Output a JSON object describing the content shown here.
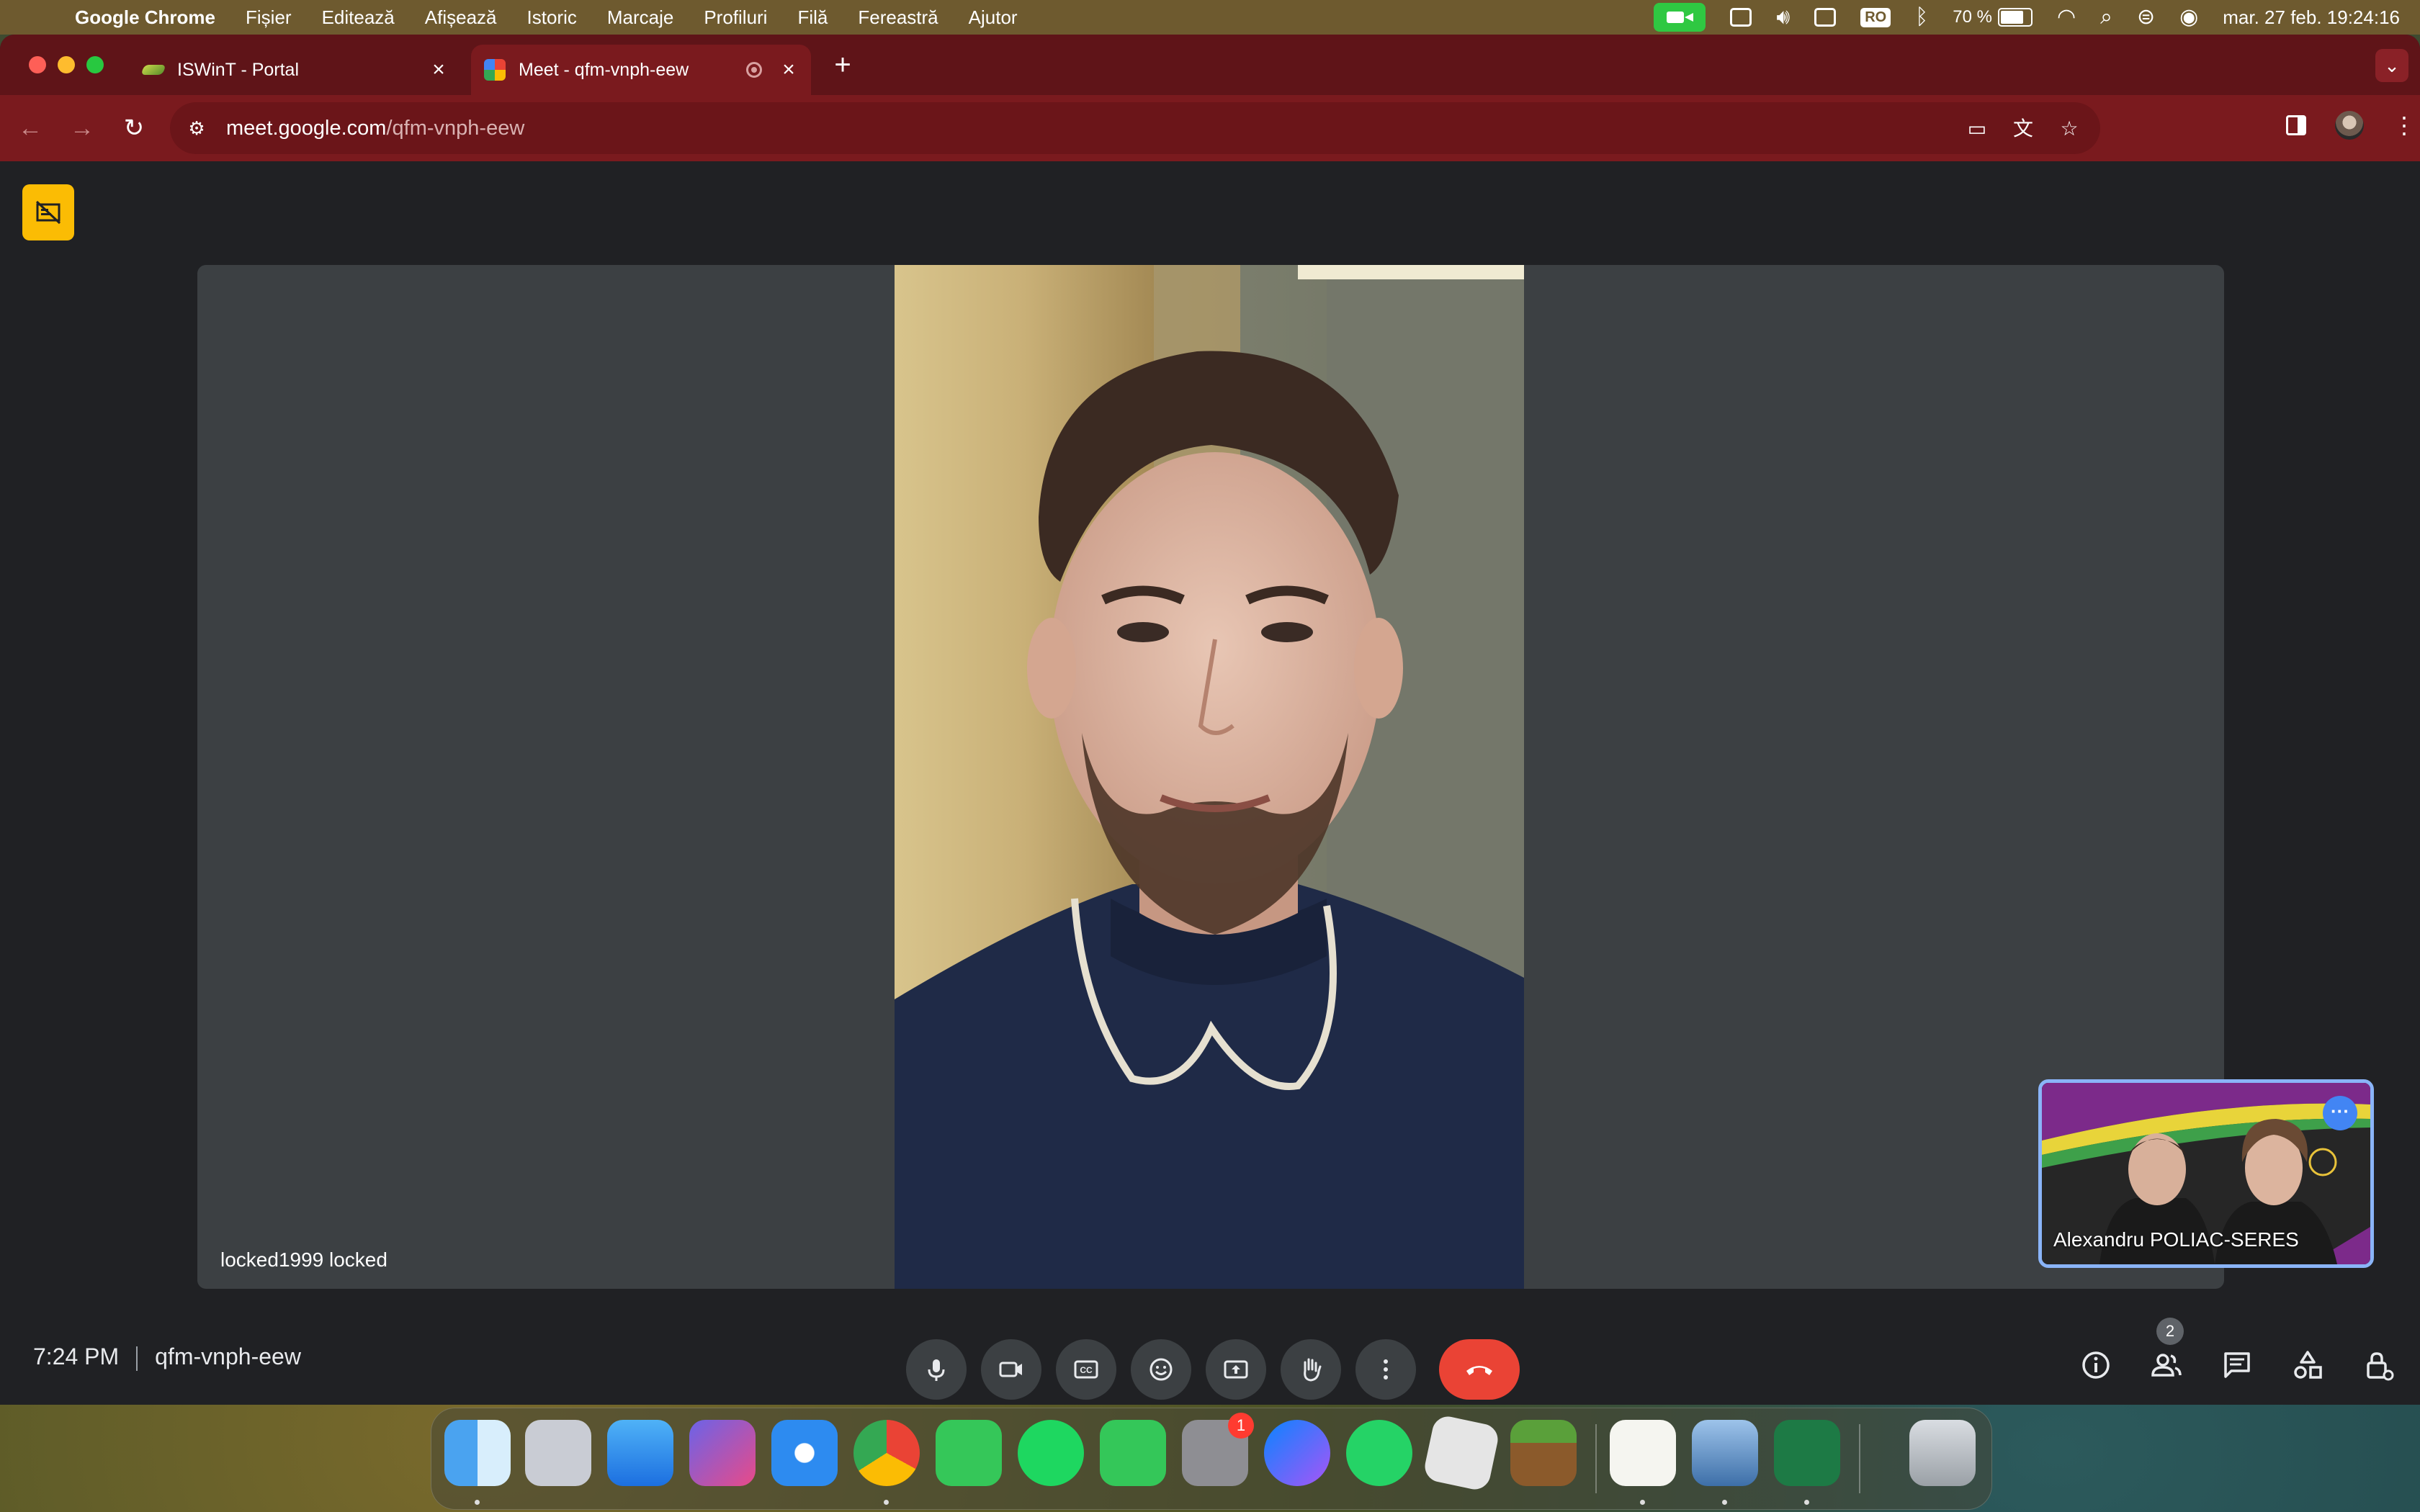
{
  "menubar": {
    "app_name": "Google Chrome",
    "items": [
      "Fișier",
      "Editează",
      "Afișează",
      "Istoric",
      "Marcaje",
      "Profiluri",
      "Filă",
      "Fereastră",
      "Ajutor"
    ],
    "input_source": "RO",
    "battery": "70 %",
    "clock": "mar. 27 feb.  19:24:16"
  },
  "browser": {
    "tabs": [
      {
        "title": "ISWinT - Portal",
        "active": false
      },
      {
        "title": "Meet - qfm-vnph-eew",
        "active": true
      }
    ],
    "url_host": "meet.google.com",
    "url_path": "/qfm-vnph-eew"
  },
  "meet": {
    "main_participant": "locked1999 locked",
    "thumbnail_participant": "Alexandru POLIAC-SERES",
    "time": "7:24 PM",
    "meeting_code": "qfm-vnph-eew",
    "people_count": "2",
    "controls": [
      "microphone",
      "camera",
      "captions",
      "emoji",
      "present",
      "raise-hand",
      "more-options",
      "leave-call"
    ],
    "right_controls": [
      "meeting-details",
      "people",
      "chat",
      "activities",
      "host-controls"
    ]
  },
  "dock": {
    "apps": [
      "Finder",
      "Launchpad",
      "Mail",
      "Affinity",
      "Safari",
      "Chrome",
      "Messages",
      "Spotify",
      "Cursor",
      "System Settings",
      "Messenger",
      "WhatsApp",
      "Roblox",
      "Minecraft",
      "TextEdit",
      "Preview",
      "Excel",
      "Trash"
    ],
    "settings_badge": "1"
  }
}
